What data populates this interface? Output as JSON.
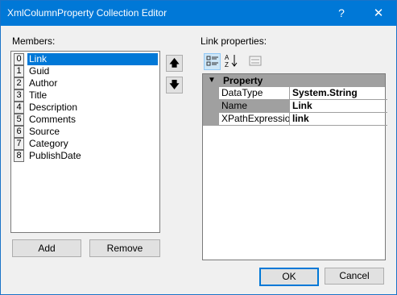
{
  "window": {
    "title": "XmlColumnProperty Collection Editor",
    "help_glyph": "?",
    "close_glyph": "✕"
  },
  "members": {
    "label": "Members:",
    "selected_index": 0,
    "items": [
      {
        "index": "0",
        "name": "Link"
      },
      {
        "index": "1",
        "name": "Guid"
      },
      {
        "index": "2",
        "name": "Author"
      },
      {
        "index": "3",
        "name": "Title"
      },
      {
        "index": "4",
        "name": "Description"
      },
      {
        "index": "5",
        "name": "Comments"
      },
      {
        "index": "6",
        "name": "Source"
      },
      {
        "index": "7",
        "name": "Category"
      },
      {
        "index": "8",
        "name": "PublishDate"
      }
    ],
    "move_up_glyph": "🡅",
    "move_down_glyph": "🡇",
    "add_label": "Add",
    "remove_label": "Remove"
  },
  "properties": {
    "label": "Link properties:",
    "toolbar": {
      "categorized_icon": "categorized-icon",
      "alphabetical_icon": "alphabetical-icon",
      "property_pages_icon": "property-pages-icon"
    },
    "category": {
      "toggle": "▼",
      "title": "Property"
    },
    "rows": [
      {
        "name": "DataType",
        "value": "System.String"
      },
      {
        "name": "Name",
        "value": "Link"
      },
      {
        "name": "XPathExpression",
        "value": "link"
      }
    ],
    "selected_row": 1
  },
  "footer": {
    "ok_label": "OK",
    "cancel_label": "Cancel"
  }
}
